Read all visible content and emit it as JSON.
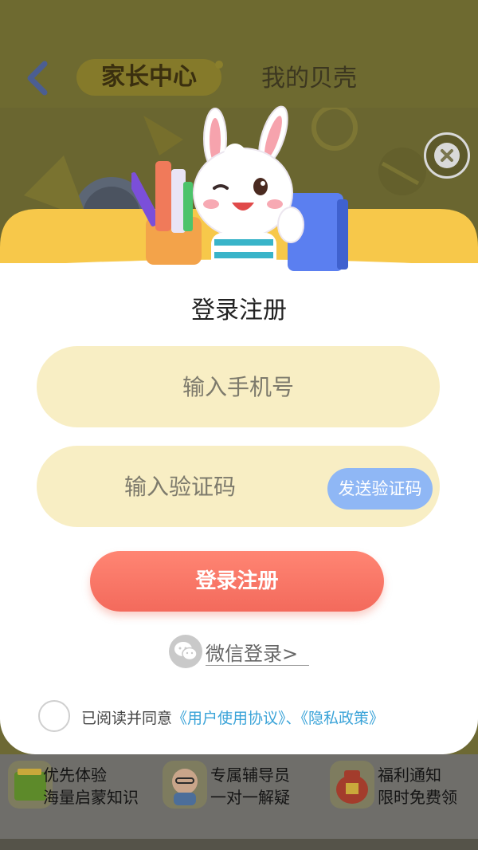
{
  "background": {
    "tabs": [
      {
        "label": "家长中心",
        "active": true
      },
      {
        "label": "我的贝壳",
        "active": false
      }
    ],
    "features": [
      {
        "line1": "优先体验",
        "line2": "海量启蒙知识",
        "icon": "book-icon"
      },
      {
        "line1": "专属辅导员",
        "line2": "一对一解疑",
        "icon": "tutor-icon"
      },
      {
        "line1": "福利通知",
        "line2": "限时免费领",
        "icon": "gift-bag-icon"
      }
    ]
  },
  "modal": {
    "title": "登录注册",
    "phone_placeholder": "输入手机号",
    "code_placeholder": "输入验证码",
    "send_code_label": "发送验证码",
    "login_button_label": "登录注册",
    "wechat_login_label": "微信登录>",
    "agreement": {
      "prefix": "已阅读并同意",
      "user_agreement": "《用户使用协议》",
      "separator": "、",
      "privacy_policy": "《隐私政策》",
      "checked": false
    }
  },
  "colors": {
    "banner": "#f7c84a",
    "input_bg": "#f8eec4",
    "send_button": "#8fb7f5",
    "login_button": "#f66f5f",
    "link": "#3aa3d8"
  }
}
